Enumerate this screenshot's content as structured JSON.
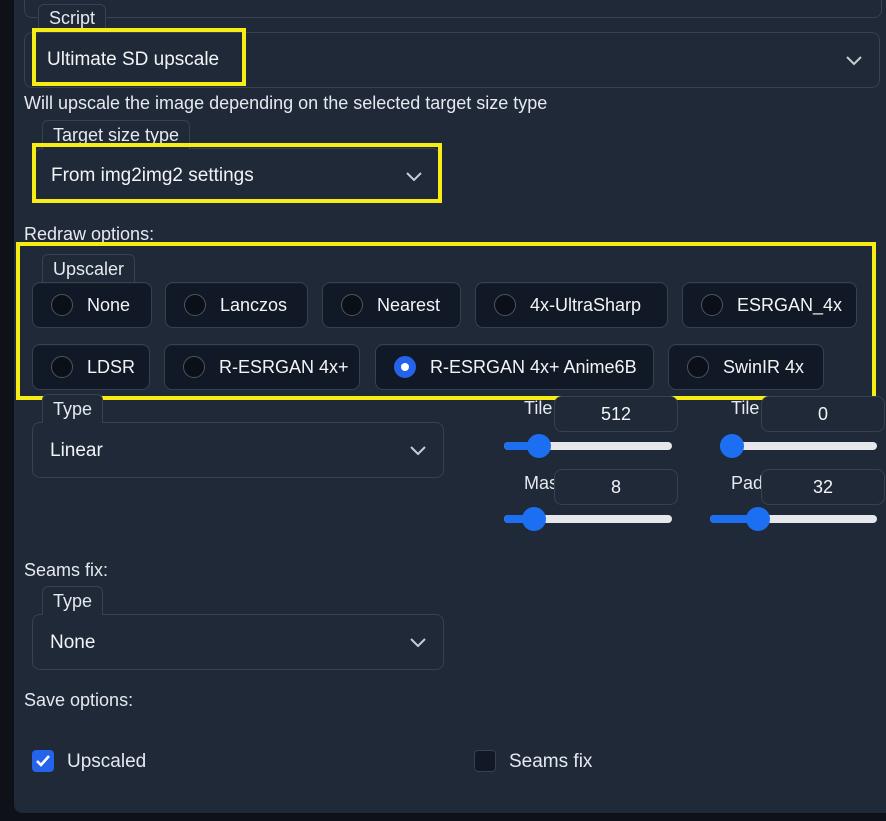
{
  "script": {
    "label": "Script",
    "selected": "Ultimate SD upscale",
    "description": "Will upscale the image depending on the selected target size type"
  },
  "target_size": {
    "label": "Target size type",
    "selected": "From img2img2 settings"
  },
  "redraw": {
    "heading": "Redraw options:",
    "upscaler_label": "Upscaler",
    "options": [
      "None",
      "Lanczos",
      "Nearest",
      "4x-UltraSharp",
      "ESRGAN_4x",
      "LDSR",
      "R-ESRGAN 4x+",
      "R-ESRGAN 4x+ Anime6B",
      "SwinIR 4x"
    ],
    "selected": "R-ESRGAN 4x+ Anime6B",
    "type_label": "Type",
    "type_selected": "Linear"
  },
  "sliders": {
    "tile_width": {
      "label": "Tile",
      "value": "512",
      "fraction": 0.16
    },
    "tile_height": {
      "label": "Tile",
      "value": "0",
      "fraction": 0.0
    },
    "mask_blur": {
      "label": "Mas",
      "value": "8",
      "fraction": 0.125
    },
    "padding": {
      "label": "Pad",
      "value": "32",
      "fraction": 0.25
    }
  },
  "seams": {
    "heading": "Seams fix:",
    "type_label": "Type",
    "type_selected": "None"
  },
  "save": {
    "heading": "Save options:",
    "upscaled_label": "Upscaled",
    "upscaled_checked": true,
    "seams_label": "Seams fix",
    "seams_checked": false
  },
  "colors": {
    "accent": "#2563eb",
    "highlight": "#f7ec13",
    "panel": "#1f2937"
  }
}
